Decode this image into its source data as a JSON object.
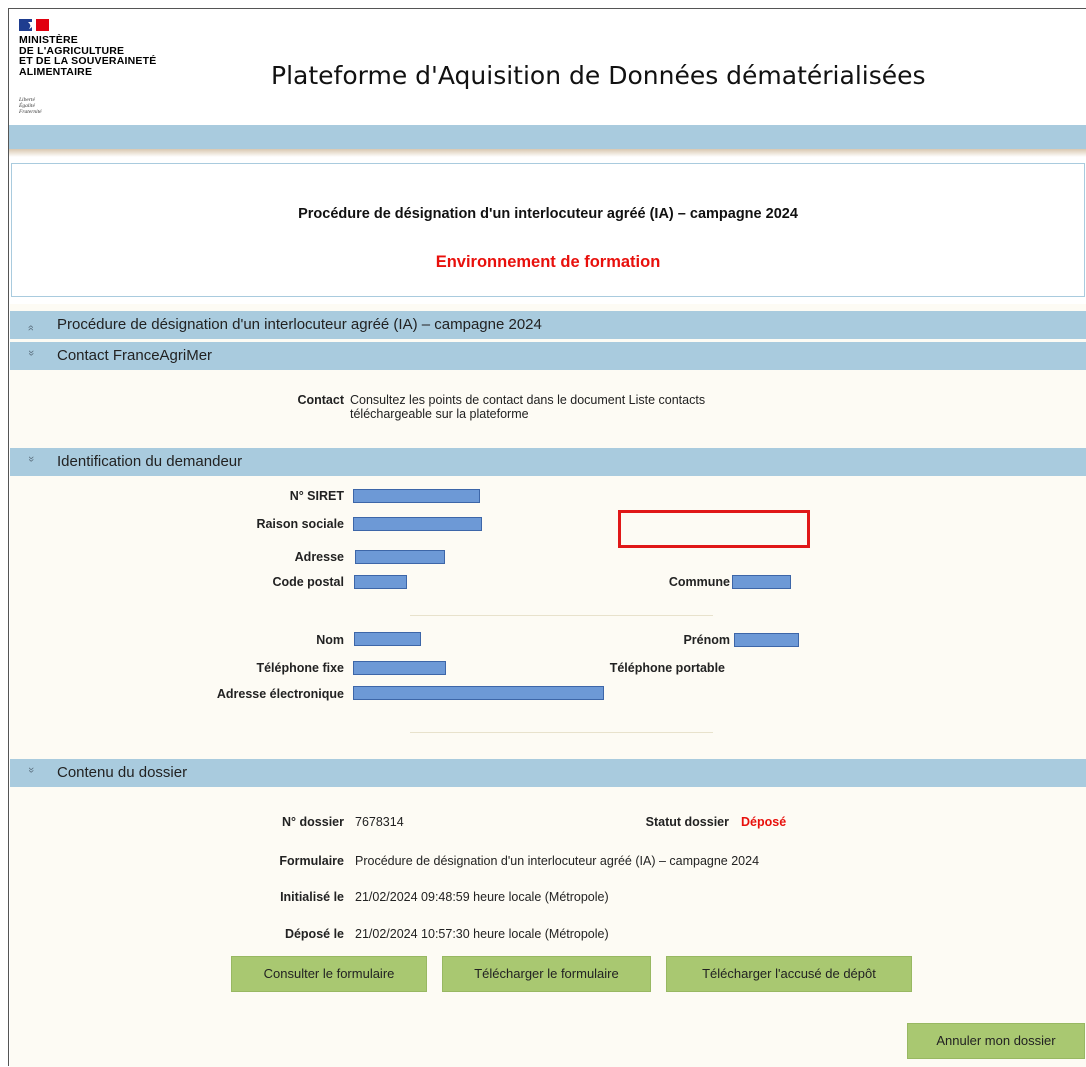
{
  "header": {
    "ministry_lines": [
      "MINISTÈRE",
      "DE L'AGRICULTURE",
      "ET DE LA SOUVERAINETÉ",
      "ALIMENTAIRE"
    ],
    "motto_lines": [
      "Liberté",
      "Égalité",
      "Fraternité"
    ],
    "app_title": "Plateforme d'Aquisition de Données dématérialisées"
  },
  "banner": {
    "title": "Procédure de désignation d'un interlocuteur agréé (IA) – campagne 2024",
    "environment": "Environnement de formation"
  },
  "sections": {
    "procedure": {
      "label": "Procédure de désignation d'un interlocuteur agréé (IA) – campagne 2024",
      "icon": "chevron-double-up-icon"
    },
    "contact": {
      "label": "Contact FranceAgriMer",
      "icon": "chevron-double-down-icon",
      "contact_label": "Contact",
      "contact_line1": "Consultez les points de contact dans le document Liste contacts",
      "contact_line2": "téléchargeable sur la plateforme"
    },
    "identification": {
      "label": "Identification du demandeur",
      "icon": "chevron-double-down-icon",
      "siret": "N° SIRET",
      "raison_sociale": "Raison sociale",
      "adresse": "Adresse",
      "code_postal": "Code postal",
      "commune": "Commune",
      "nom": "Nom",
      "prenom": "Prénom",
      "tel_fixe": "Téléphone fixe",
      "tel_portable": "Téléphone portable",
      "email": "Adresse électronique"
    },
    "dossier": {
      "label": "Contenu du dossier",
      "icon": "chevron-double-down-icon",
      "num_label": "N° dossier",
      "num_value": "7678314",
      "status_label": "Statut dossier",
      "status_value": "Déposé",
      "form_label": "Formulaire",
      "form_value": "Procédure de désignation d'un interlocuteur agréé (IA) – campagne 2024",
      "init_label": "Initialisé le",
      "init_value": "21/02/2024 09:48:59 heure locale (Métropole)",
      "depose_label": "Déposé le",
      "depose_value": "21/02/2024 10:57:30 heure locale (Métropole)"
    }
  },
  "buttons": {
    "consulter": "Consulter le formulaire",
    "telecharger": "Télécharger le formulaire",
    "accuse": "Télécharger l'accusé de dépôt",
    "annuler": "Annuler mon dossier"
  },
  "colors": {
    "section_bar": "#a9cbde",
    "env_red": "#e8100c",
    "button_green": "#a9c871",
    "redaction_blue": "#6d99d6"
  }
}
